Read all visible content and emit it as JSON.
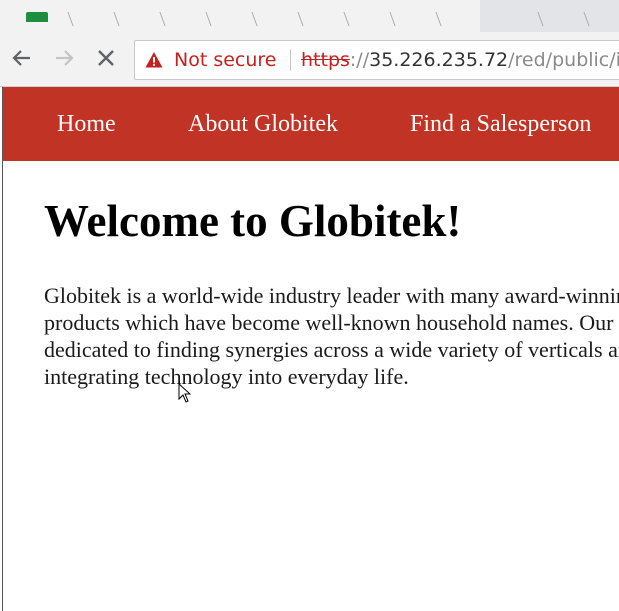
{
  "browser": {
    "security_label": "Not secure",
    "url": {
      "scheme": "https",
      "separator": "://",
      "host": "35.226.235.72",
      "path": "/red/public/in"
    }
  },
  "site": {
    "nav_items": [
      {
        "label": "Home"
      },
      {
        "label": "About Globitek"
      },
      {
        "label": "Find a Salesperson"
      }
    ],
    "colors": {
      "navbar": "#c13325"
    }
  },
  "main": {
    "title": "Welcome to Globitek!",
    "intro": "Globitek is a world-wide industry leader with many award-winning products which have become well-known household names. Our staff is dedicated to finding synergies across a wide variety of verticals and integrating technology into everyday life."
  }
}
